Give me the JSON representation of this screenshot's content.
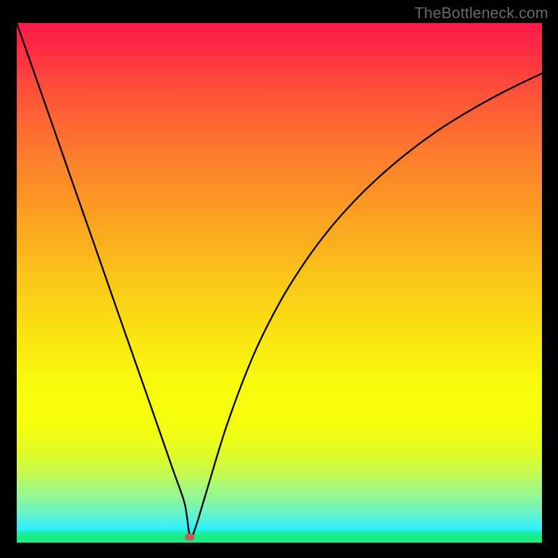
{
  "watermark": "TheBottleneck.com",
  "chart_data": {
    "type": "line",
    "title": "",
    "xlabel": "",
    "ylabel": "",
    "xlim": [
      0,
      100
    ],
    "ylim": [
      0,
      100
    ],
    "grid": false,
    "legend": false,
    "notes": "Bottleneck-style V-curve over red-to-green vertical gradient. Minimum (optimal point) near x≈33. Marker indicates optimal point at curve minimum. No axis ticks or numeric labels visible.",
    "series": [
      {
        "name": "bottleneck-curve",
        "x": [
          0,
          5,
          10,
          15,
          20,
          25,
          28,
          30,
          32,
          33,
          34,
          36,
          40,
          45,
          50,
          55,
          60,
          65,
          70,
          75,
          80,
          85,
          90,
          95,
          100
        ],
        "y": [
          100.0,
          85.6,
          71.1,
          56.7,
          42.2,
          27.8,
          19.1,
          13.3,
          7.4,
          1.1,
          2.8,
          9.4,
          22.6,
          35.9,
          46.1,
          54.2,
          60.9,
          66.5,
          71.3,
          75.5,
          79.2,
          82.4,
          85.3,
          87.9,
          90.3
        ]
      }
    ],
    "marker": {
      "x": 33,
      "y": 1.1,
      "color": "#c75c52"
    },
    "gradient_colors": {
      "top": "#fe1a49",
      "mid": "#f9e112",
      "bottom": "#19ed7f"
    }
  }
}
